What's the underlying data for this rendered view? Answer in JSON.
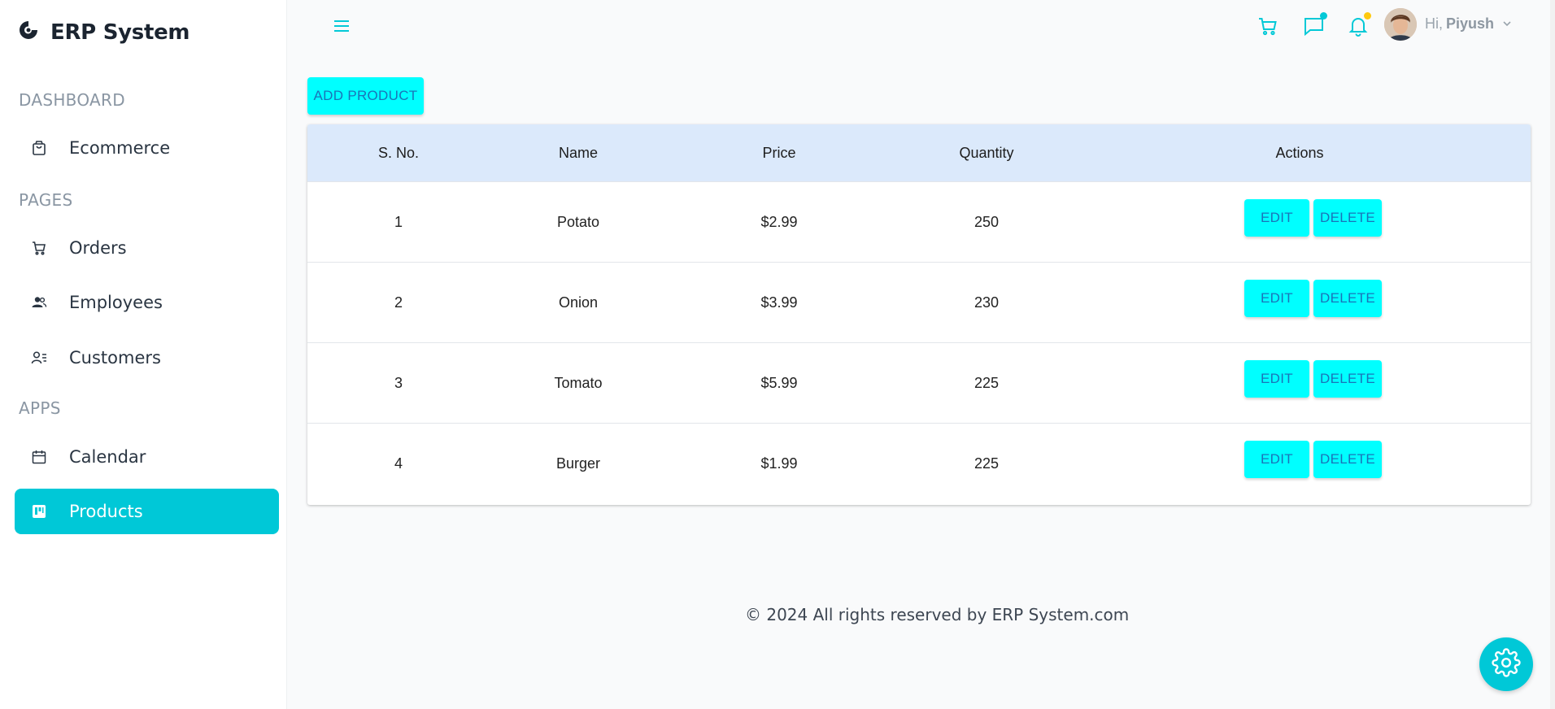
{
  "app": {
    "brand_name": "ERP System"
  },
  "sidebar": {
    "sections": [
      {
        "label": "DASHBOARD"
      },
      {
        "label": "PAGES"
      },
      {
        "label": "APPS"
      }
    ],
    "items": [
      {
        "label": "Ecommerce",
        "icon": "shopping-bag-icon"
      },
      {
        "label": "Orders",
        "icon": "cart-icon"
      },
      {
        "label": "Employees",
        "icon": "users-icon"
      },
      {
        "label": "Customers",
        "icon": "customer-list-icon"
      },
      {
        "label": "Calendar",
        "icon": "calendar-icon"
      },
      {
        "label": "Products",
        "icon": "kanban-icon",
        "active": true
      }
    ]
  },
  "topbar": {
    "greeting": "Hi,",
    "user_name": "Piyush",
    "icons": [
      "cart-icon",
      "chat-icon",
      "bell-icon"
    ],
    "badge_colors": {
      "chat": "#03c9d7",
      "bell": "#fec90f"
    }
  },
  "main": {
    "add_button_label": "ADD PRODUCT",
    "table": {
      "columns": [
        "S. No.",
        "Name",
        "Price",
        "Quantity",
        "Actions"
      ],
      "rows": [
        {
          "sno": "1",
          "name": "Potato",
          "price": "$2.99",
          "quantity": "250"
        },
        {
          "sno": "2",
          "name": "Onion",
          "price": "$3.99",
          "quantity": "230"
        },
        {
          "sno": "3",
          "name": "Tomato",
          "price": "$5.99",
          "quantity": "225"
        },
        {
          "sno": "4",
          "name": "Burger",
          "price": "$1.99",
          "quantity": "225"
        }
      ],
      "edit_label": "EDIT",
      "delete_label": "DELETE"
    }
  },
  "footer": {
    "text": "© 2024 All rights reserved by ERP System.com"
  },
  "colors": {
    "accent": "#03c9d7",
    "button_bg": "#00ffff",
    "button_text": "#1a74b8",
    "table_header_bg": "#dbe9fb"
  }
}
